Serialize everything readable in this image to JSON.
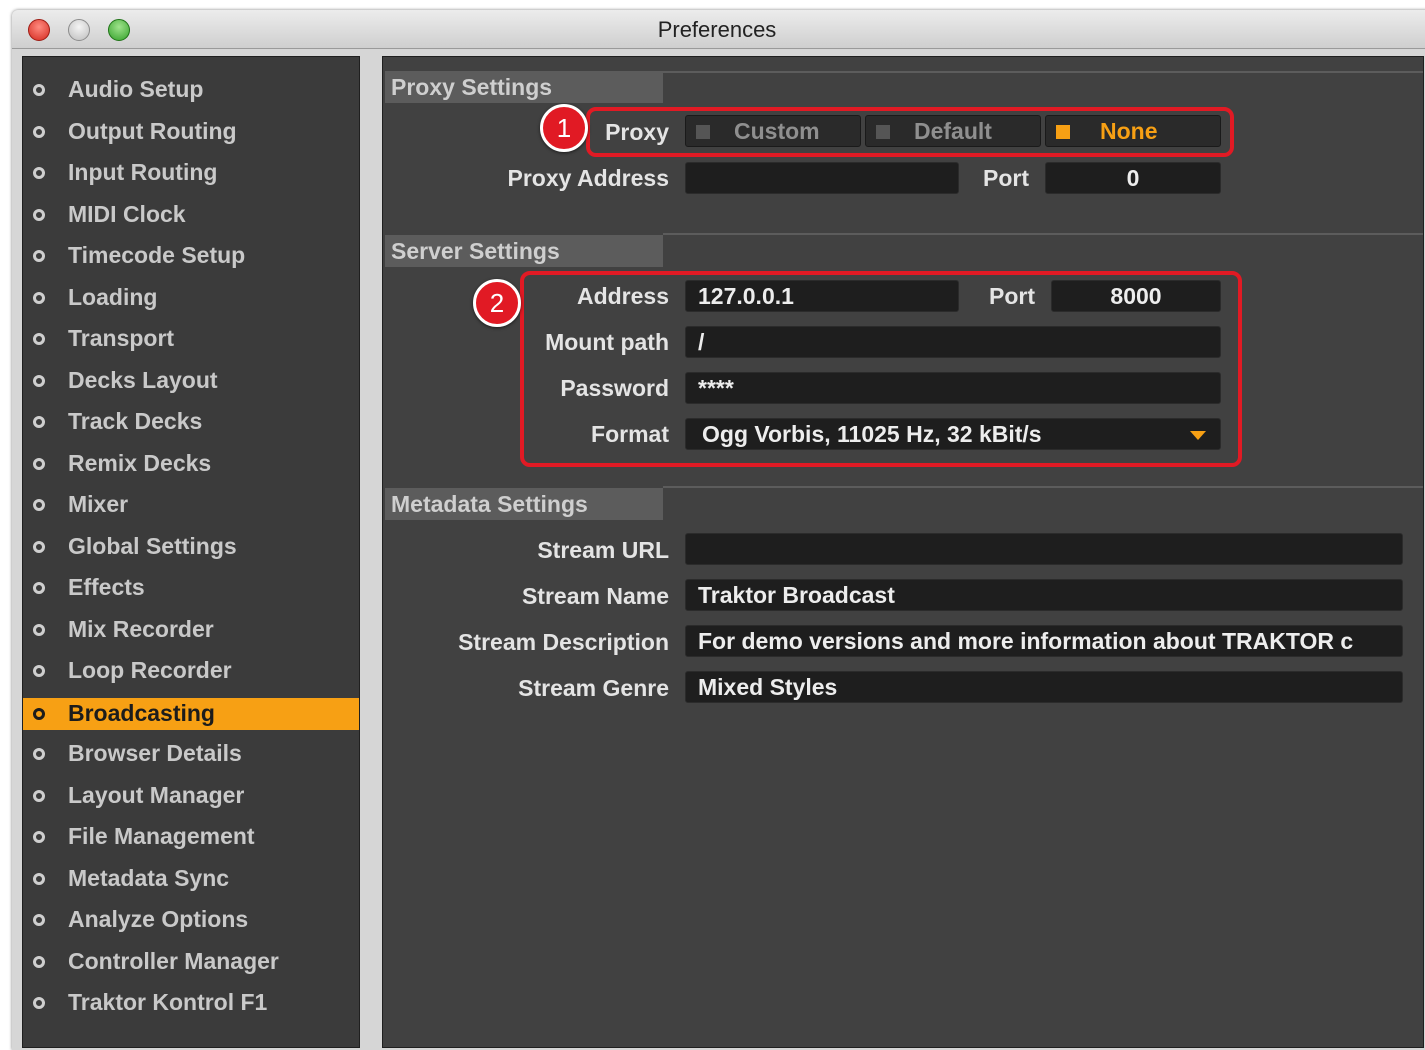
{
  "window": {
    "title": "Preferences"
  },
  "sidebar": {
    "items": [
      {
        "label": "Audio Setup",
        "active": false
      },
      {
        "label": "Output Routing",
        "active": false
      },
      {
        "label": "Input Routing",
        "active": false
      },
      {
        "label": "MIDI Clock",
        "active": false
      },
      {
        "label": "Timecode Setup",
        "active": false
      },
      {
        "label": "Loading",
        "active": false
      },
      {
        "label": "Transport",
        "active": false
      },
      {
        "label": "Decks Layout",
        "active": false
      },
      {
        "label": "Track Decks",
        "active": false
      },
      {
        "label": "Remix Decks",
        "active": false
      },
      {
        "label": "Mixer",
        "active": false
      },
      {
        "label": "Global Settings",
        "active": false
      },
      {
        "label": "Effects",
        "active": false
      },
      {
        "label": "Mix Recorder",
        "active": false
      },
      {
        "label": "Loop Recorder",
        "active": false
      },
      {
        "label": "Broadcasting",
        "active": true
      },
      {
        "label": "Browser Details",
        "active": false
      },
      {
        "label": "Layout Manager",
        "active": false
      },
      {
        "label": "File Management",
        "active": false
      },
      {
        "label": "Metadata Sync",
        "active": false
      },
      {
        "label": "Analyze Options",
        "active": false
      },
      {
        "label": "Controller Manager",
        "active": false
      },
      {
        "label": "Traktor Kontrol F1",
        "active": false
      }
    ]
  },
  "proxy": {
    "section_title": "Proxy Settings",
    "proxy_label": "Proxy",
    "options": [
      {
        "label": "Custom",
        "selected": false
      },
      {
        "label": "Default",
        "selected": false
      },
      {
        "label": "None",
        "selected": true
      }
    ],
    "address_label": "Proxy Address",
    "address_value": "",
    "port_label": "Port",
    "port_value": "0"
  },
  "server": {
    "section_title": "Server Settings",
    "address_label": "Address",
    "address_value": "127.0.0.1",
    "port_label": "Port",
    "port_value": "8000",
    "mount_label": "Mount path",
    "mount_value": "/",
    "password_label": "Password",
    "password_value": "****",
    "format_label": "Format",
    "format_value": "Ogg Vorbis, 11025 Hz, 32 kBit/s"
  },
  "metadata": {
    "section_title": "Metadata Settings",
    "url_label": "Stream URL",
    "url_value": "",
    "name_label": "Stream Name",
    "name_value": "Traktor Broadcast",
    "desc_label": "Stream Description",
    "desc_value": "For demo versions and more information about TRAKTOR c",
    "genre_label": "Stream Genre",
    "genre_value": "Mixed Styles"
  },
  "annotations": {
    "badge1": "1",
    "badge2": "2"
  },
  "colors": {
    "accent": "#f7a014",
    "callout": "#e11a24",
    "panel": "#414141",
    "sidebar": "#3b3b3b"
  }
}
